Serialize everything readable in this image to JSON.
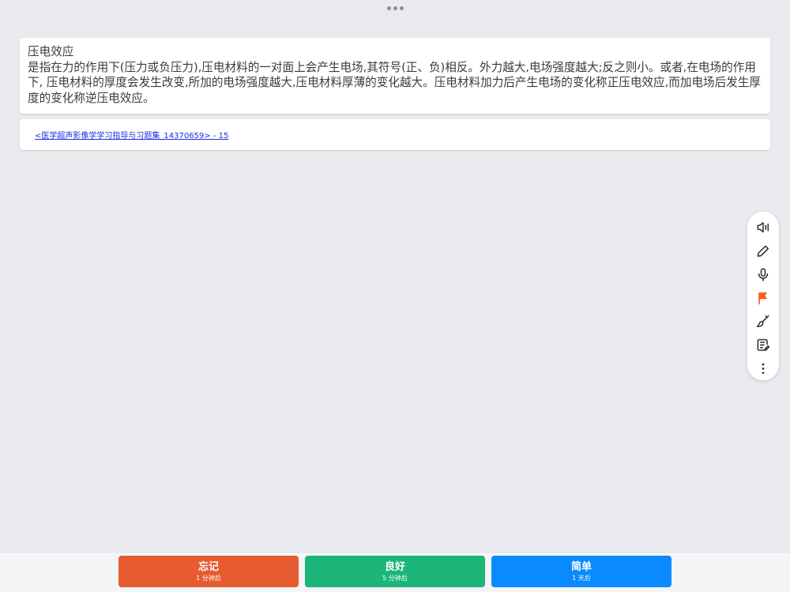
{
  "card": {
    "front": "压电效应",
    "back": "是指在力的作用下(压力或负压力),压电材料的一对面上会产生电场,其符号(正、负)相反。外力越大,电场强度越大;反之则小。或者,在电场的作用下, 压电材料的厚度会发生改变,所加的电场强度越大,压电材料厚薄的变化越大。压电材料加力后产生电场的变化称正压电效应,而加电场后发生厚度的变化称逆压电效应。"
  },
  "source": {
    "link_text": "<医学超声影像学学习指导与习题集_14370659> - 15"
  },
  "toolbar": {
    "icons": [
      "speaker-icon",
      "pencil-icon",
      "microphone-icon",
      "flag-icon",
      "brush-icon",
      "edit-note-icon",
      "more-vertical-icon"
    ],
    "flag_color": "#ff5a1f"
  },
  "answers": [
    {
      "label": "忘记",
      "interval": "1 分钟后",
      "color": "#e65c30"
    },
    {
      "label": "良好",
      "interval": "5 分钟后",
      "color": "#1db57a"
    },
    {
      "label": "简单",
      "interval": "1 天后",
      "color": "#0a8aff"
    }
  ]
}
